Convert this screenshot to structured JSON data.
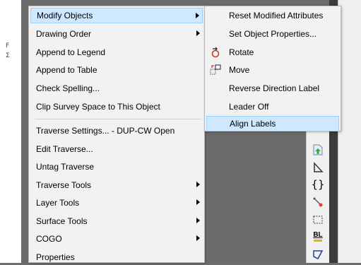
{
  "background": {
    "left_ticks": [
      "F",
      "Σ"
    ]
  },
  "main_menu": {
    "items": [
      {
        "label": "Modify Objects",
        "submenu": true
      },
      {
        "label": "Drawing Order",
        "submenu": true
      },
      {
        "label": "Append to Legend",
        "submenu": false
      },
      {
        "label": "Append to Table",
        "submenu": false
      },
      {
        "label": "Check Spelling...",
        "submenu": false
      },
      {
        "label": "Clip Survey Space to This Object",
        "submenu": false
      },
      {
        "label": "Traverse Settings... - DUP-CW Open",
        "submenu": false
      },
      {
        "label": "Edit Traverse...",
        "submenu": false
      },
      {
        "label": "Untag Traverse",
        "submenu": false
      },
      {
        "label": "Traverse Tools",
        "submenu": true
      },
      {
        "label": "Layer Tools",
        "submenu": true
      },
      {
        "label": "Surface Tools",
        "submenu": true
      },
      {
        "label": "COGO",
        "submenu": true
      },
      {
        "label": "Properties",
        "submenu": false
      }
    ]
  },
  "sub_menu": {
    "items": [
      {
        "label": "Reset Modified Attributes",
        "icon": ""
      },
      {
        "label": "Set Object Properties...",
        "icon": ""
      },
      {
        "label": "Rotate",
        "icon": "rotate-icon"
      },
      {
        "label": "Move",
        "icon": "move-icon"
      },
      {
        "label": "Reverse Direction Label",
        "icon": ""
      },
      {
        "label": "Leader Off",
        "icon": ""
      },
      {
        "label": "Align Labels",
        "icon": ""
      }
    ]
  },
  "toolbar": {
    "icons": [
      "insert-point-icon",
      "triangle-shape-icon",
      "curly-braces-icon",
      "line-node-icon",
      "dashed-rectangle-icon",
      "bl-label-icon",
      "polygon-icon"
    ],
    "bl_text": "BL",
    "braces_text": "{}"
  },
  "colors": {
    "highlight_bg": "#cde8ff",
    "highlight_border": "#99d1ff",
    "menu_bg": "#f2f2f2"
  }
}
